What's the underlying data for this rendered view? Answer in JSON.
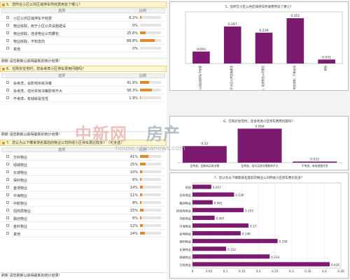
{
  "q5": {
    "title": "5、您所在小区公共区域停车所收费用去了哪儿？",
    "col_option": "选项",
    "col_ratio": "比例",
    "rows": [
      {
        "label": "小区公共区域停车不收费",
        "pct": "6.2%",
        "value": 0.062
      },
      {
        "label": "物业收取，用于小区公共设施建设",
        "pct": "0%",
        "value": 0.0
      },
      {
        "label": "物业收取，挂进物业公司腰包",
        "pct": "25.6%",
        "value": 0.256
      },
      {
        "label": "物业收取，不知去向",
        "pct": "68.8%",
        "value": 0.688
      },
      {
        "label": "其他",
        "pct": "0%",
        "value": 0.0
      }
    ],
    "refresh": "刷新  请您刷新以获得最新的统计结果！"
  },
  "q6": {
    "title": "6、在购买住宅时，您会考虑小区停车费用问题吗？",
    "col_option": "选项",
    "col_ratio": "比例",
    "rows": [
      {
        "label": "会考虑，会影响买房决策",
        "pct": "41.9%",
        "value": 0.419
      },
      {
        "label": "会考虑，但对买房决策影响不大",
        "pct": "56.3%",
        "value": 0.563
      },
      {
        "label": "不考虑，有钱就是任性",
        "pct": "1.9%",
        "value": 0.019
      }
    ],
    "refresh": "刷新  请您刷新以获得最新的统计结果！"
  },
  "q7": {
    "title": "7、您认为以下哪家排名靠前的物业公司所收小区停车费比较多？（可多选）",
    "col_option": "选项",
    "col_ratio": "比例",
    "rows": [
      {
        "label": "万科物业",
        "pct": "41%",
        "value": 0.41
      },
      {
        "label": "绿城物业",
        "pct": "25%",
        "value": 0.25
      },
      {
        "label": "长城物业",
        "pct": "10%",
        "value": 0.1
      },
      {
        "label": "保利物业",
        "pct": "6%",
        "value": 0.06
      },
      {
        "label": "金地物业",
        "pct": "14%",
        "value": 0.14
      },
      {
        "label": "中海物业",
        "pct": "11%",
        "value": 0.11
      },
      {
        "label": "中航物业",
        "pct": "8%",
        "value": 0.08
      },
      {
        "label": "招商局物业",
        "pct": "15%",
        "value": 0.15
      },
      {
        "label": "融创物业",
        "pct": "6%",
        "value": 0.06
      },
      {
        "label": "金科物业",
        "pct": "12%",
        "value": 0.12
      },
      {
        "label": "其他",
        "pct": "24%",
        "value": 0.24
      }
    ],
    "refresh": "刷新  请您刷新以获得最新的统计结果！"
  },
  "watermark": {
    "brand_cn": "中新网",
    "brand_cn2": "房产",
    "url": "house.chinanews.com"
  },
  "chart_data": [
    {
      "type": "bar",
      "title": "5、您所在小区公共区域停车所收费用去了哪儿？",
      "categories": [
        "小区公共区域停车不收费",
        "物业收取，用于小区公共设施建设",
        "物业收取，挂进物业公司腰包",
        "物业收取，不知去向",
        "其他"
      ],
      "values": [
        0.093,
        0.287,
        0.239,
        0.351,
        0.031
      ],
      "value_labels": [
        "0.093",
        "0.287",
        "0.239",
        "0.351",
        "0.031"
      ],
      "ylim": [
        0,
        0.4
      ],
      "color": "#7b1a6e"
    },
    {
      "type": "bar",
      "title": "6、在购买住宅时，您会考虑小区停车费用问题吗？",
      "categories": [
        "会考虑，会影响买房决策",
        "会考虑，但对买房决策影响不大",
        "不考虑，有钱就是任性"
      ],
      "values": [
        0.32,
        0.656,
        0.022
      ],
      "value_labels": [
        "0.32",
        "0.656",
        "0.022"
      ],
      "ylim": [
        0,
        0.7
      ],
      "color": "#7b1a6e"
    },
    {
      "type": "bar",
      "orientation": "horizontal",
      "title": "7、您认为以下哪家排名靠前的物业公司所收小区停车费比较多？",
      "categories": [
        "其他",
        "金科物业",
        "融创物业",
        "招商局物业",
        "中航物业",
        "中海物业",
        "金地物业",
        "保利物业",
        "长城物业",
        "绿城物业",
        "万科物业"
      ],
      "values": [
        0.057,
        0.126,
        0.061,
        0.155,
        0.067,
        0.17,
        0.146,
        0.258,
        0.102,
        0.234,
        0.416
      ],
      "value_labels": [
        "0.057",
        "0.126",
        "0.061",
        "0.155",
        "0.067",
        "0.17",
        "0.146",
        "0.258",
        "0.102",
        "0.234",
        "0.416"
      ],
      "xlim": [
        0,
        0.45
      ],
      "xticks": [
        "0",
        "0.05",
        "0.1",
        "0.15",
        "0.2",
        "0.25",
        "0.3",
        "0.35",
        "0.4",
        "0.45"
      ],
      "color": "#7b1a6e"
    }
  ]
}
